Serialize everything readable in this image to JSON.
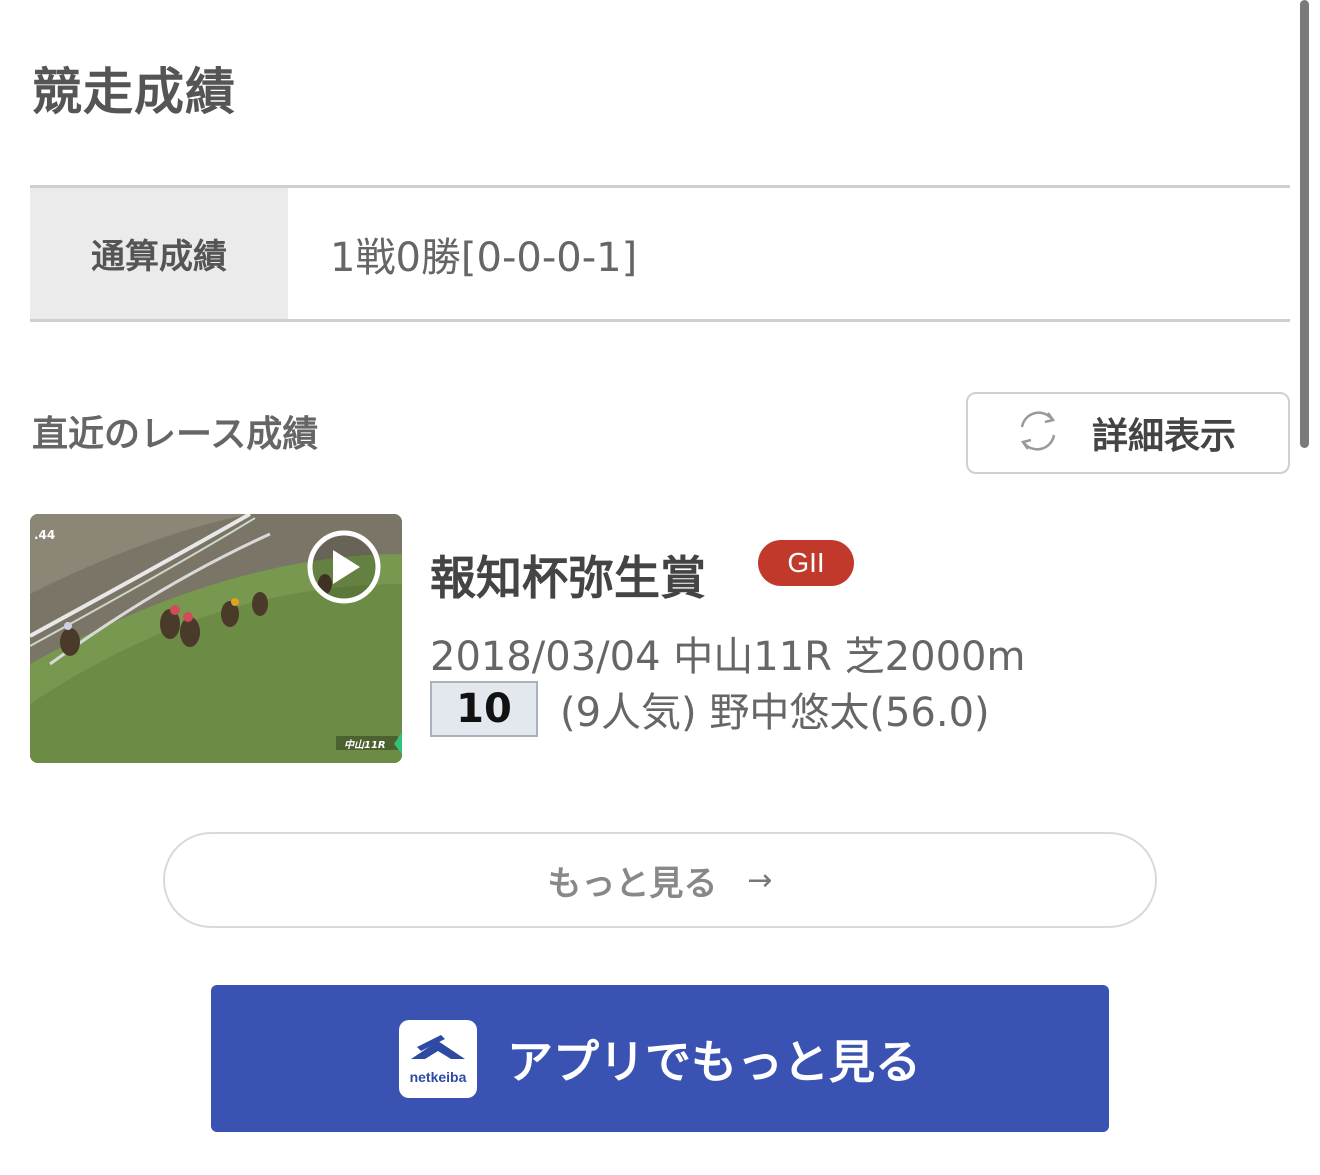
{
  "page": {
    "title": "競走成績"
  },
  "summary": {
    "label": "通算成績",
    "value": "1戦0勝[0-0-0-1]"
  },
  "recent": {
    "title": "直近のレース成績",
    "detail_button": "詳細表示"
  },
  "race": {
    "name": "報知杯弥生賞",
    "grade": "GII",
    "info": "2018/03/04 中山11R 芝2000m",
    "rank": "10",
    "detail": "(9人気) 野中悠太(56.0)",
    "video": {
      "time_overlay": ".44",
      "course_overlay": "中山11R"
    }
  },
  "more_button": {
    "label": "もっと見る",
    "arrow": "→"
  },
  "app_button": {
    "logo_text": "netkeiba",
    "label": "アプリでもっと見る"
  },
  "colors": {
    "grade_badge": "#c0392b",
    "app_button": "#3a53b3",
    "rank_box": "#e3e8ee"
  }
}
